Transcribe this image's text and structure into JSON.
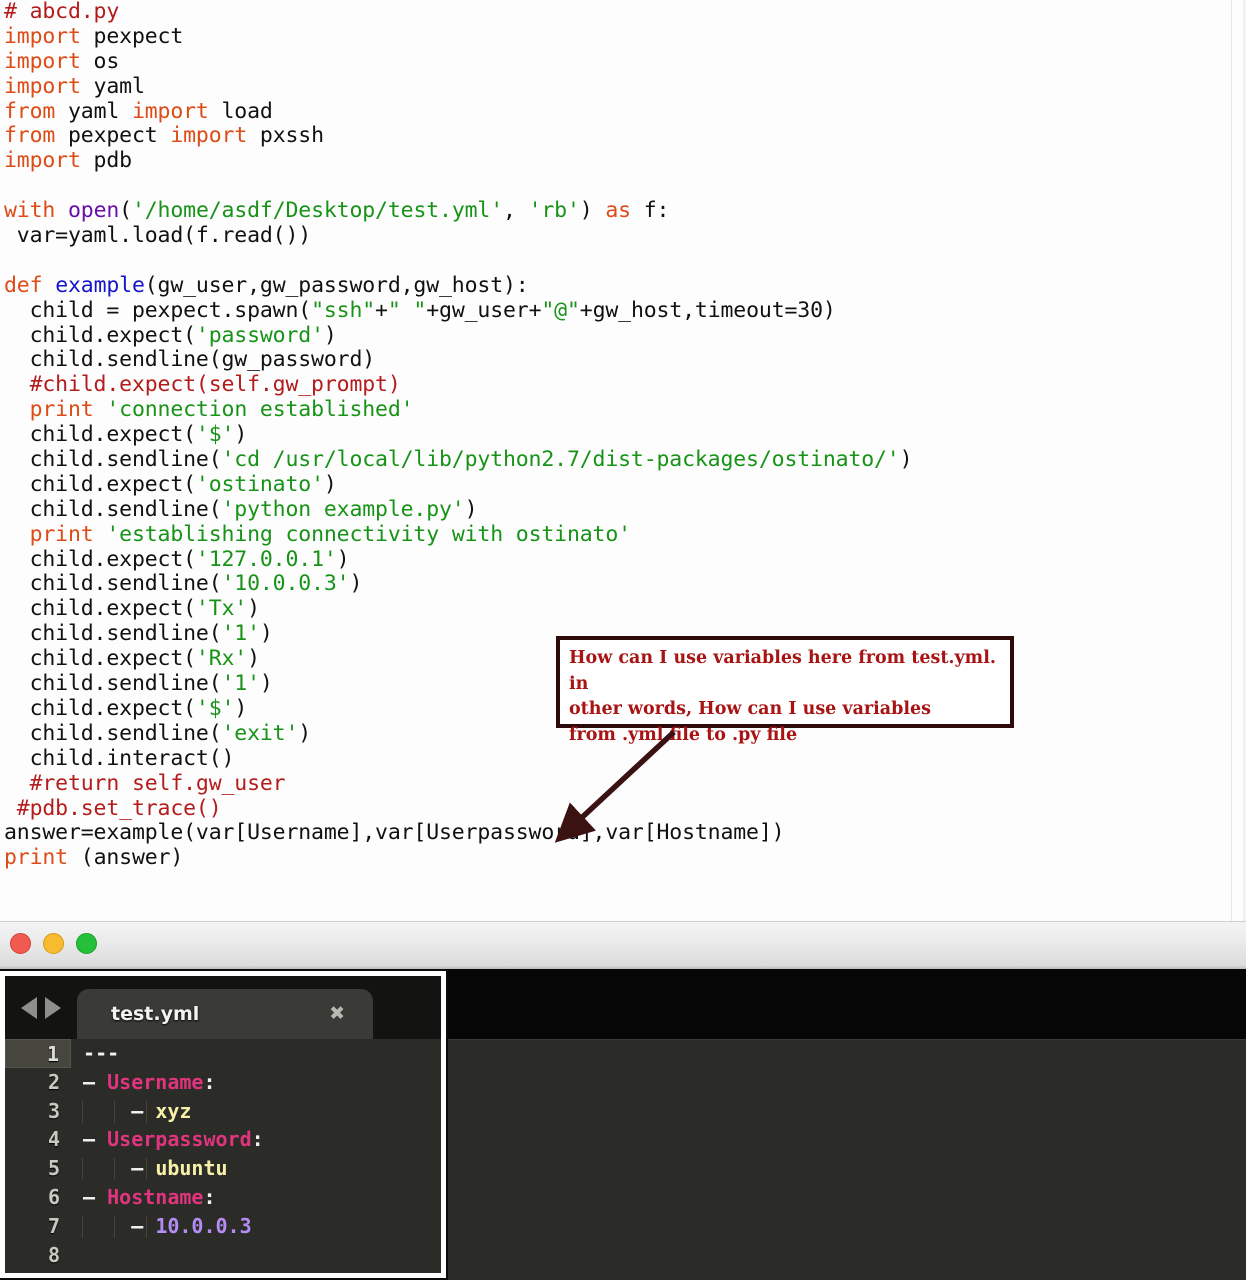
{
  "code_pane": {
    "language": "python",
    "filename_comment": "# abcd.py",
    "lines": [
      [
        {
          "t": "# abcd.py",
          "c": "cmt"
        }
      ],
      [
        {
          "t": "import",
          "c": "kw"
        },
        {
          "t": " pexpect",
          "c": "pln"
        }
      ],
      [
        {
          "t": "import",
          "c": "kw"
        },
        {
          "t": " os",
          "c": "pln"
        }
      ],
      [
        {
          "t": "import",
          "c": "kw"
        },
        {
          "t": " yaml",
          "c": "pln"
        }
      ],
      [
        {
          "t": "from",
          "c": "kw"
        },
        {
          "t": " yaml ",
          "c": "pln"
        },
        {
          "t": "import",
          "c": "kw"
        },
        {
          "t": " load",
          "c": "pln"
        }
      ],
      [
        {
          "t": "from",
          "c": "kw"
        },
        {
          "t": " pexpect ",
          "c": "pln"
        },
        {
          "t": "import",
          "c": "kw"
        },
        {
          "t": " pxssh",
          "c": "pln"
        }
      ],
      [
        {
          "t": "import",
          "c": "kw"
        },
        {
          "t": " pdb",
          "c": "pln"
        }
      ],
      [
        {
          "t": "",
          "c": "pln"
        }
      ],
      [
        {
          "t": "with",
          "c": "kw"
        },
        {
          "t": " ",
          "c": "pln"
        },
        {
          "t": "open",
          "c": "bi"
        },
        {
          "t": "(",
          "c": "pln"
        },
        {
          "t": "'/home/asdf/Desktop/test.yml'",
          "c": "str"
        },
        {
          "t": ", ",
          "c": "pln"
        },
        {
          "t": "'rb'",
          "c": "str"
        },
        {
          "t": ") ",
          "c": "pln"
        },
        {
          "t": "as",
          "c": "kw"
        },
        {
          "t": " f:",
          "c": "pln"
        }
      ],
      [
        {
          "t": " var=yaml.load(f.read())",
          "c": "pln"
        }
      ],
      [
        {
          "t": "",
          "c": "pln"
        }
      ],
      [
        {
          "t": "def",
          "c": "kw"
        },
        {
          "t": " ",
          "c": "pln"
        },
        {
          "t": "example",
          "c": "fn"
        },
        {
          "t": "(gw_user,gw_password,gw_host):",
          "c": "pln"
        }
      ],
      [
        {
          "t": "  child = pexpect.spawn(",
          "c": "pln"
        },
        {
          "t": "\"ssh\"",
          "c": "str"
        },
        {
          "t": "+",
          "c": "pln"
        },
        {
          "t": "\" \"",
          "c": "str"
        },
        {
          "t": "+gw_user+",
          "c": "pln"
        },
        {
          "t": "\"@\"",
          "c": "str"
        },
        {
          "t": "+gw_host,timeout=30)",
          "c": "pln"
        }
      ],
      [
        {
          "t": "  child.expect(",
          "c": "pln"
        },
        {
          "t": "'password'",
          "c": "str"
        },
        {
          "t": ")",
          "c": "pln"
        }
      ],
      [
        {
          "t": "  child.sendline(gw_password)",
          "c": "pln"
        }
      ],
      [
        {
          "t": "  #child.expect(self.gw_prompt)",
          "c": "cmt"
        }
      ],
      [
        {
          "t": "  ",
          "c": "pln"
        },
        {
          "t": "print",
          "c": "kw"
        },
        {
          "t": " ",
          "c": "pln"
        },
        {
          "t": "'connection established'",
          "c": "str"
        }
      ],
      [
        {
          "t": "  child.expect(",
          "c": "pln"
        },
        {
          "t": "'$'",
          "c": "str"
        },
        {
          "t": ")",
          "c": "pln"
        }
      ],
      [
        {
          "t": "  child.sendline(",
          "c": "pln"
        },
        {
          "t": "'cd /usr/local/lib/python2.7/dist-packages/ostinato/'",
          "c": "str"
        },
        {
          "t": ")",
          "c": "pln"
        }
      ],
      [
        {
          "t": "  child.expect(",
          "c": "pln"
        },
        {
          "t": "'ostinato'",
          "c": "str"
        },
        {
          "t": ")",
          "c": "pln"
        }
      ],
      [
        {
          "t": "  child.sendline(",
          "c": "pln"
        },
        {
          "t": "'python example.py'",
          "c": "str"
        },
        {
          "t": ")",
          "c": "pln"
        }
      ],
      [
        {
          "t": "  ",
          "c": "pln"
        },
        {
          "t": "print",
          "c": "kw"
        },
        {
          "t": " ",
          "c": "pln"
        },
        {
          "t": "'establishing connectivity with ostinato'",
          "c": "str"
        }
      ],
      [
        {
          "t": "  child.expect(",
          "c": "pln"
        },
        {
          "t": "'127.0.0.1'",
          "c": "str"
        },
        {
          "t": ")",
          "c": "pln"
        }
      ],
      [
        {
          "t": "  child.sendline(",
          "c": "pln"
        },
        {
          "t": "'10.0.0.3'",
          "c": "str"
        },
        {
          "t": ")",
          "c": "pln"
        }
      ],
      [
        {
          "t": "  child.expect(",
          "c": "pln"
        },
        {
          "t": "'Tx'",
          "c": "str"
        },
        {
          "t": ")",
          "c": "pln"
        }
      ],
      [
        {
          "t": "  child.sendline(",
          "c": "pln"
        },
        {
          "t": "'1'",
          "c": "str"
        },
        {
          "t": ")",
          "c": "pln"
        }
      ],
      [
        {
          "t": "  child.expect(",
          "c": "pln"
        },
        {
          "t": "'Rx'",
          "c": "str"
        },
        {
          "t": ")",
          "c": "pln"
        }
      ],
      [
        {
          "t": "  child.sendline(",
          "c": "pln"
        },
        {
          "t": "'1'",
          "c": "str"
        },
        {
          "t": ")",
          "c": "pln"
        }
      ],
      [
        {
          "t": "  child.expect(",
          "c": "pln"
        },
        {
          "t": "'$'",
          "c": "str"
        },
        {
          "t": ")",
          "c": "pln"
        }
      ],
      [
        {
          "t": "  child.sendline(",
          "c": "pln"
        },
        {
          "t": "'exit'",
          "c": "str"
        },
        {
          "t": ")",
          "c": "pln"
        }
      ],
      [
        {
          "t": "  child.interact()",
          "c": "pln"
        }
      ],
      [
        {
          "t": "  #return self.gw_user",
          "c": "cmt"
        }
      ],
      [
        {
          "t": " #pdb.set_trace()",
          "c": "cmt"
        }
      ],
      [
        {
          "t": "answer=example(var[Username],var[Userpassword],var[Hostname])",
          "c": "pln"
        }
      ],
      [
        {
          "t": "print",
          "c": "kw"
        },
        {
          "t": " (answer)",
          "c": "pln"
        }
      ]
    ]
  },
  "annotation": {
    "text": "How can I use variables here from test.yml. in\nother words, How can I use variables\nfrom .yml file to .py file",
    "text_color": "#a81414",
    "border_color": "#2d0b0b",
    "arrow_color": "#3a1212"
  },
  "window": {
    "traffic_lights": [
      {
        "name": "close",
        "color": "#f05a50"
      },
      {
        "name": "minimize",
        "color": "#f6bb2e"
      },
      {
        "name": "maximize",
        "color": "#25c03a"
      }
    ]
  },
  "editor": {
    "nav_back_icon": "triangle-left",
    "nav_forward_icon": "triangle-right",
    "tab": {
      "label": "test.yml",
      "close_glyph": "✖"
    },
    "gutter_numbers": [
      "1",
      "2",
      "3",
      "4",
      "5",
      "6",
      "7",
      "8"
    ],
    "active_line": 1,
    "yaml_lines": [
      {
        "num": "1",
        "guides": 0,
        "dash": false,
        "segments": [
          {
            "t": "---",
            "c": "ydoc"
          }
        ]
      },
      {
        "num": "2",
        "guides": 0,
        "dash": true,
        "segments": [
          {
            "t": "Username",
            "c": "ykey"
          },
          {
            "t": ":",
            "c": "ydoc"
          }
        ]
      },
      {
        "num": "3",
        "guides": 3,
        "dash": true,
        "indent": 3,
        "segments": [
          {
            "t": "xyz",
            "c": "yval"
          }
        ]
      },
      {
        "num": "4",
        "guides": 0,
        "dash": true,
        "segments": [
          {
            "t": "Userpassword",
            "c": "ykey"
          },
          {
            "t": ":",
            "c": "ydoc"
          }
        ]
      },
      {
        "num": "5",
        "guides": 3,
        "dash": true,
        "indent": 3,
        "segments": [
          {
            "t": "ubuntu",
            "c": "yval"
          }
        ]
      },
      {
        "num": "6",
        "guides": 0,
        "dash": true,
        "segments": [
          {
            "t": "Hostname",
            "c": "ykey"
          },
          {
            "t": ":",
            "c": "ydoc"
          }
        ]
      },
      {
        "num": "7",
        "guides": 3,
        "dash": true,
        "indent": 3,
        "segments": [
          {
            "t": "10.0.0.3",
            "c": "ynum"
          }
        ]
      },
      {
        "num": "8",
        "guides": 0,
        "dash": false,
        "segments": []
      }
    ],
    "colors": {
      "key": "#e0357e",
      "value": "#f6f0a8",
      "number": "#b48cf2",
      "background": "#2b2b28",
      "gutter_text": "#c9c9c2"
    }
  }
}
